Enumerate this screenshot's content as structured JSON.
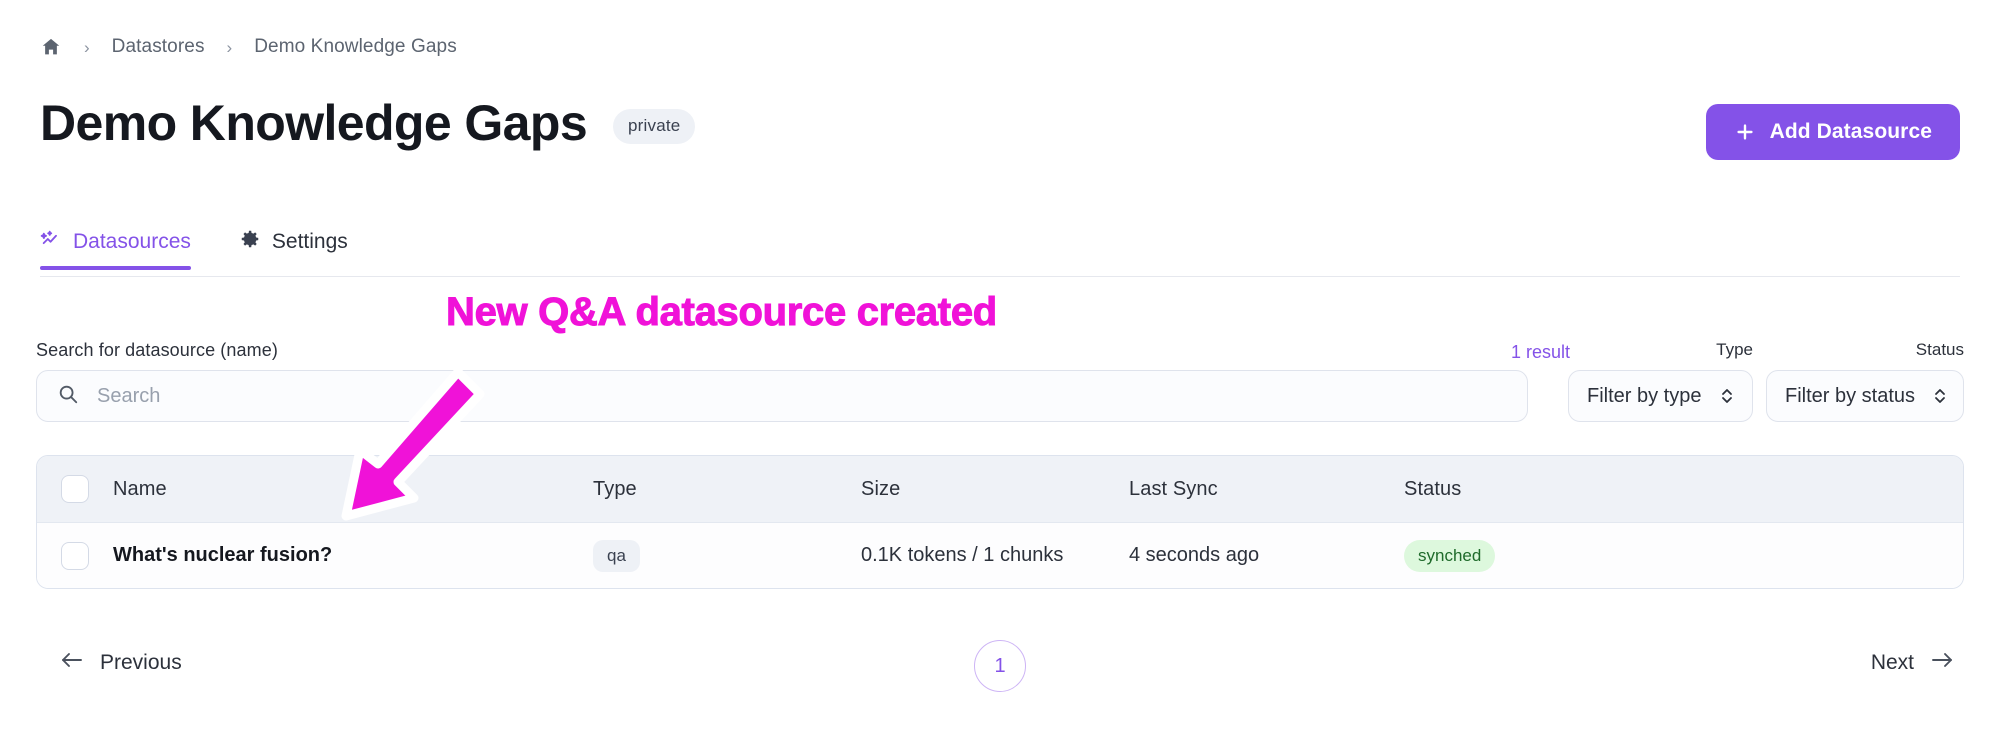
{
  "breadcrumb": {
    "home_icon": "home-icon",
    "separator": "›",
    "items": [
      {
        "label": "Datastores"
      },
      {
        "label": "Demo Knowledge Gaps"
      }
    ]
  },
  "header": {
    "title": "Demo Knowledge Gaps",
    "visibility_badge": "private",
    "add_button": {
      "label": "Add Datasource",
      "icon": "plus-icon",
      "bg_color": "#8452e8",
      "text_color": "#ffffff"
    }
  },
  "tabs": [
    {
      "label": "Datasources",
      "icon": "sparkle-chart-icon",
      "active": true
    },
    {
      "label": "Settings",
      "icon": "gear-icon",
      "active": false
    }
  ],
  "search": {
    "label": "Search for datasource (name)",
    "placeholder": "Search",
    "value": "",
    "icon": "search-icon"
  },
  "results": {
    "count_label": "1 result",
    "count_color": "#8452e8"
  },
  "filters": [
    {
      "caption": "Type",
      "placeholder": "Filter by type",
      "icon": "stepper-chevrons-icon"
    },
    {
      "caption": "Status",
      "placeholder": "Filter by status",
      "icon": "stepper-chevrons-icon"
    }
  ],
  "table": {
    "columns": [
      "Name",
      "Type",
      "Size",
      "Last Sync",
      "Status"
    ],
    "select_all_checked": false,
    "rows": [
      {
        "checked": false,
        "name": "What's nuclear fusion?",
        "type": "qa",
        "size": "0.1K tokens / 1 chunks",
        "last_sync": "4 seconds ago",
        "status": "synched",
        "status_bg": "#ddf8dd",
        "status_color": "#1f6b2b"
      }
    ]
  },
  "pagination": {
    "previous_label": "Previous",
    "next_label": "Next",
    "current_page": "1",
    "prev_icon": "arrow-left-icon",
    "next_icon": "arrow-right-icon"
  },
  "annotation": {
    "text": "New Q&A datasource created",
    "color": "#f012d8",
    "arrow_icon": "arrow-down-left-annotation-icon"
  }
}
